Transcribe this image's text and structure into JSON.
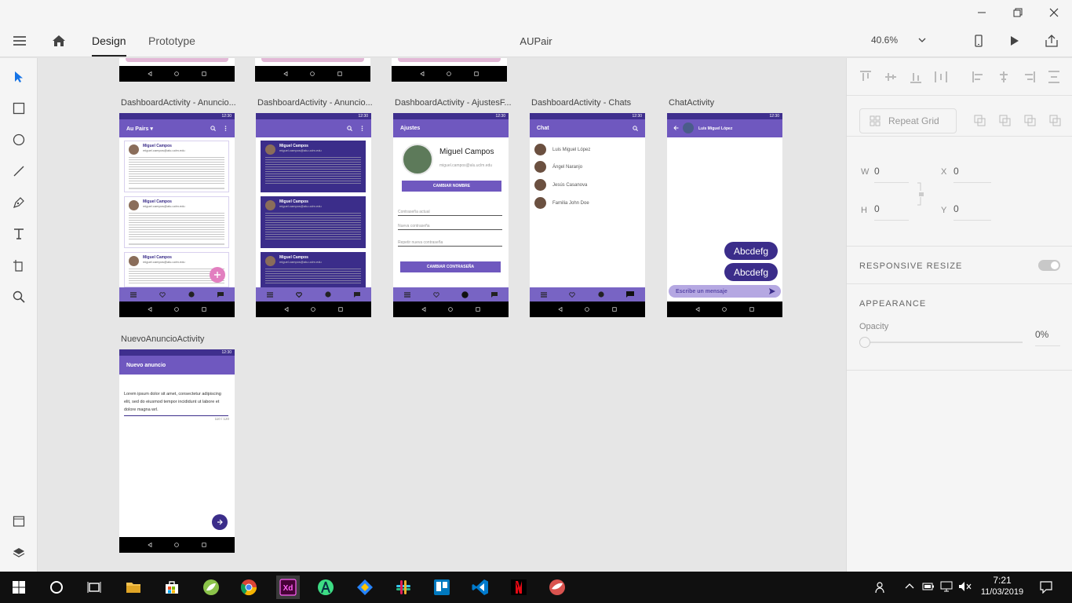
{
  "window": {
    "title": "AUPair",
    "minimize_icon": "minimize-icon",
    "restore_icon": "restore-icon",
    "close_icon": "close-icon"
  },
  "topbar": {
    "tabs": [
      {
        "label": "Design",
        "active": true
      },
      {
        "label": "Prototype",
        "active": false
      }
    ],
    "zoom": "40.6%"
  },
  "artboards": [
    {
      "label": "DashboardActivity - Anuncio..."
    },
    {
      "label": "DashboardActivity - Anuncio..."
    },
    {
      "label": "DashboardActivity - AjustesF..."
    },
    {
      "label": "DashboardActivity - Chats"
    },
    {
      "label": "ChatActivity"
    },
    {
      "label": "NuevoAnuncioActivity"
    }
  ],
  "mock": {
    "status_time": "12:30",
    "aupairs_title": "Au Pairs ▾",
    "card_name": "Miguel Campos",
    "card_email": "miguel.campos@alu.uclm.edu",
    "settings": {
      "title": "Ajustes",
      "name": "Miguel Campos",
      "email": "miguel.campos@alu.uclm.edu",
      "change_name": "CAMBIAR NOMBRE",
      "current_pw": "Contraseña actual",
      "new_pw": "Nueva contraseña",
      "repeat_pw": "Repetir nueva contraseña",
      "change_pw": "CAMBIAR CONTRASEÑA"
    },
    "chats": {
      "title": "Chat",
      "contacts": [
        "Luis Miguel López",
        "Ángel Naranjo",
        "Jesús Casanova",
        "Familia John Doe"
      ]
    },
    "chat_activity": {
      "contact": "Luis Miguel López",
      "bubbles": [
        "Abcdefg",
        "Abcdefg"
      ],
      "placeholder": "Escribe un mensaje"
    },
    "new_ad": {
      "title": "Nuevo anuncio",
      "body": "Lorem ipsum dolor sit amet, consectetur adipiscing elit, sed do eiusmod tempor incididunt ut labore et dolore magna wrl.",
      "counter": "110 / 120"
    }
  },
  "panel": {
    "repeat_grid": "Repeat Grid",
    "w_label": "W",
    "w": "0",
    "h_label": "H",
    "h": "0",
    "x_label": "X",
    "x": "0",
    "y_label": "Y",
    "y": "0",
    "responsive_resize": "RESPONSIVE RESIZE",
    "appearance": "APPEARANCE",
    "opacity_label": "Opacity",
    "opacity_value": "0%"
  },
  "taskbar": {
    "time": "7:21",
    "date": "11/03/2019"
  }
}
